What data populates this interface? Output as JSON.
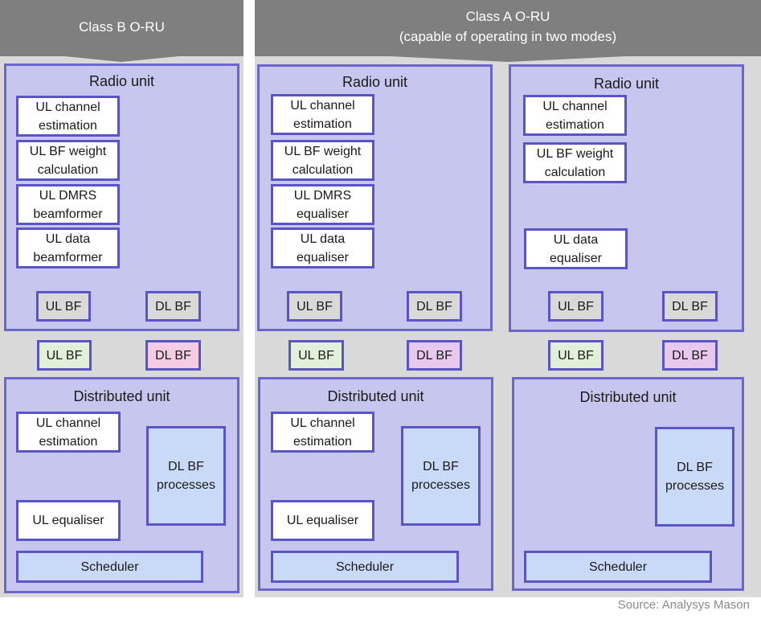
{
  "columns": {
    "class_b": {
      "header": "Class B O-RU",
      "radio_unit": {
        "title": "Radio unit",
        "blocks": [
          "UL channel\nestimation",
          "UL BF weight\ncalculation",
          "UL DMRS\nbeamformer",
          "UL data\nbeamformer"
        ],
        "ul_bf": "UL BF",
        "dl_bf": "DL BF"
      },
      "link": {
        "ul_bf": "UL BF",
        "dl_bf": "DL BF"
      },
      "distributed_unit": {
        "title": "Distributed unit",
        "channel_estimation": "UL channel\nestimation",
        "equaliser": "UL equaliser",
        "dl_bf_processes": "DL BF\nprocesses",
        "scheduler": "Scheduler"
      }
    },
    "class_a": {
      "header_line1": "Class A O-RU",
      "header_line2": "(capable of operating in two modes)",
      "mode1": {
        "radio_unit": {
          "title": "Radio unit",
          "blocks": [
            "UL channel\nestimation",
            "UL BF weight\ncalculation",
            "UL DMRS\nequaliser",
            "UL data\nequaliser"
          ],
          "ul_bf": "UL BF",
          "dl_bf": "DL BF"
        },
        "link": {
          "ul_bf": "UL BF",
          "dl_bf": "DL BF"
        },
        "distributed_unit": {
          "title": "Distributed unit",
          "channel_estimation": "UL channel\nestimation",
          "equaliser": "UL equaliser",
          "dl_bf_processes": "DL BF\nprocesses",
          "scheduler": "Scheduler"
        }
      },
      "mode2": {
        "radio_unit": {
          "title": "Radio unit",
          "blocks": [
            "UL channel\nestimation",
            "UL BF weight\ncalculation",
            "UL data\nequaliser"
          ],
          "ul_bf": "UL BF",
          "dl_bf": "DL BF"
        },
        "link": {
          "ul_bf": "UL BF",
          "dl_bf": "DL BF"
        },
        "distributed_unit": {
          "title": "Distributed unit",
          "dl_bf_processes": "DL BF\nprocesses",
          "scheduler": "Scheduler"
        }
      }
    }
  },
  "source": "Source: Analysys Mason",
  "colors": {
    "header": "#7f7f7f",
    "panel": "#c7c6ef",
    "border": "#5a54c6",
    "ul_bf_link": "#e2efd9",
    "dl_bf_link_b": "#f4cce4",
    "dl_bf_link_a": "#e8c9ee",
    "dl_bf_processes": "#c9daf8"
  }
}
